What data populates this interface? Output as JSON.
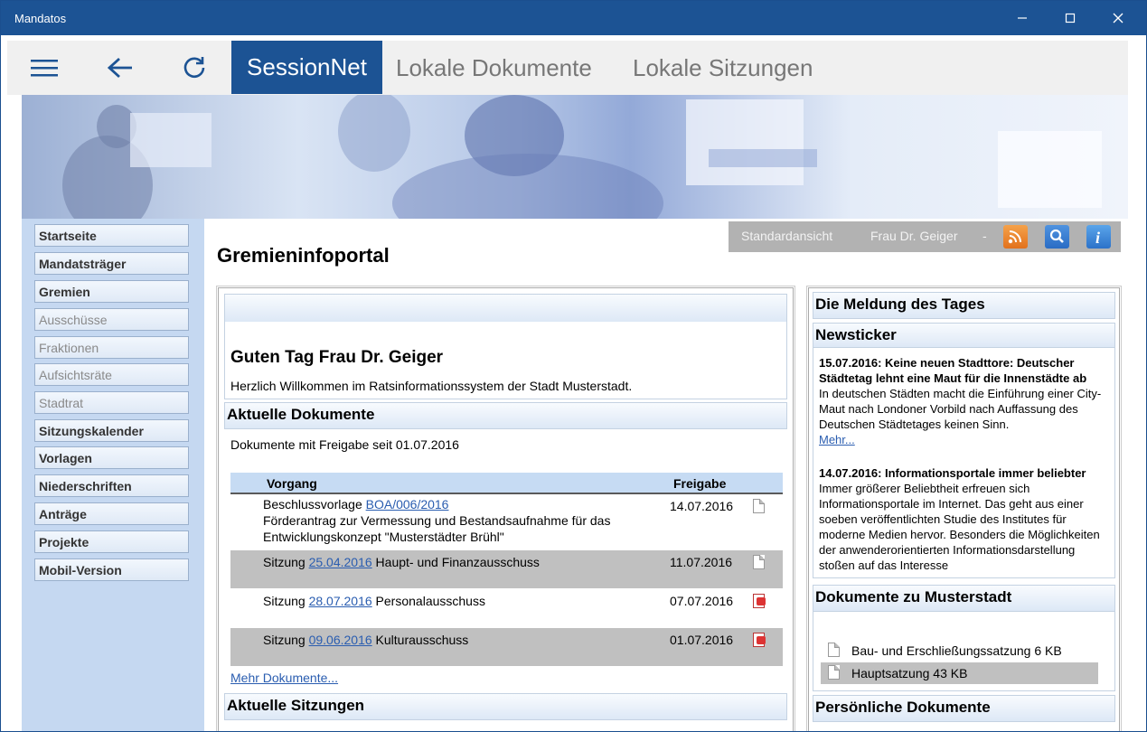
{
  "window": {
    "title": "Mandatos"
  },
  "toolbar": {
    "home_tab": "SessionNet",
    "tab_local_docs": "Lokale Dokumente",
    "tab_local_sessions": "Lokale Sitzungen"
  },
  "sidebar": {
    "items": [
      {
        "label": "Startseite",
        "style": "bold"
      },
      {
        "label": "Mandatsträger",
        "style": "bold"
      },
      {
        "label": "Gremien",
        "style": "bold"
      },
      {
        "label": "Ausschüsse",
        "style": "sub"
      },
      {
        "label": "Fraktionen",
        "style": "sub"
      },
      {
        "label": "Aufsichtsräte",
        "style": "sub"
      },
      {
        "label": "Stadtrat",
        "style": "sub"
      },
      {
        "label": "Sitzungskalender",
        "style": "bold"
      },
      {
        "label": "Vorlagen",
        "style": "bold"
      },
      {
        "label": "Niederschriften",
        "style": "bold"
      },
      {
        "label": "Anträge",
        "style": "bold"
      },
      {
        "label": "Projekte",
        "style": "bold"
      },
      {
        "label": "Mobil-Version",
        "style": "bold"
      }
    ]
  },
  "topbar": {
    "view": "Standardansicht",
    "user": "Frau Dr. Geiger",
    "sep": "-"
  },
  "page": {
    "title": "Gremieninfoportal"
  },
  "welcome": {
    "heading": "Guten Tag Frau Dr. Geiger",
    "text": "Herzlich Willkommen im Ratsinformationssystem der Stadt Musterstadt."
  },
  "docs": {
    "heading": "Aktuelle Dokumente",
    "subtitle": "Dokumente mit Freigabe seit 01.07.2016",
    "col_vorgang": "Vorgang",
    "col_freigabe": "Freigabe",
    "rows": [
      {
        "prefix": "Beschlussvorlage ",
        "link": "BOA/006/2016",
        "suffix": "",
        "line2": "Förderantrag zur Vermessung und Bestandsaufnahme für das",
        "line3": "Entwicklungskonzept \"Musterstädter Brühl\"",
        "date": "14.07.2016",
        "icon": "doc-icon"
      },
      {
        "prefix": "Sitzung ",
        "link": "25.04.2016",
        "suffix": " Haupt- und Finanzausschuss",
        "line2": "",
        "line3": "",
        "date": "11.07.2016",
        "icon": "doc-icon"
      },
      {
        "prefix": "Sitzung ",
        "link": "28.07.2016",
        "suffix": " Personalausschuss",
        "line2": "",
        "line3": "",
        "date": "07.07.2016",
        "icon": "pdf-icon"
      },
      {
        "prefix": "Sitzung ",
        "link": "09.06.2016",
        "suffix": " Kulturausschuss",
        "line2": "",
        "line3": "",
        "date": "01.07.2016",
        "icon": "pdf-icon"
      }
    ],
    "more": "Mehr Dokumente..."
  },
  "sessions": {
    "heading": "Aktuelle Sitzungen"
  },
  "right": {
    "news_of_day": "Die Meldung des Tages",
    "newsticker": "Newsticker",
    "news": [
      {
        "title": "15.07.2016: Keine neuen Stadttore: Deutscher Städtetag lehnt eine Maut für die Innenstädte ab",
        "body": "In deutschen Städten macht die Einführung einer City-Maut nach Londoner Vorbild nach Auffassung des Deutschen Städtetages keinen Sinn.",
        "more": "Mehr..."
      },
      {
        "title": "14.07.2016: Informationsportale immer beliebter",
        "body": "Immer größerer Beliebtheit erfreuen sich Informationsportale im Internet. Das geht aus einer soeben veröffentlichten Studie des Institutes für moderne Medien hervor. Besonders die Möglichkeiten der anwenderorientierten Informationsdarstellung stoßen auf das Interesse"
      }
    ],
    "city_docs_heading": "Dokumente zu Musterstadt",
    "city_docs": [
      {
        "label": "Bau- und Erschließungssatzung 6 KB"
      },
      {
        "label": "Hauptsatzung 43 KB"
      }
    ],
    "personal_docs": "Persönliche Dokumente"
  }
}
